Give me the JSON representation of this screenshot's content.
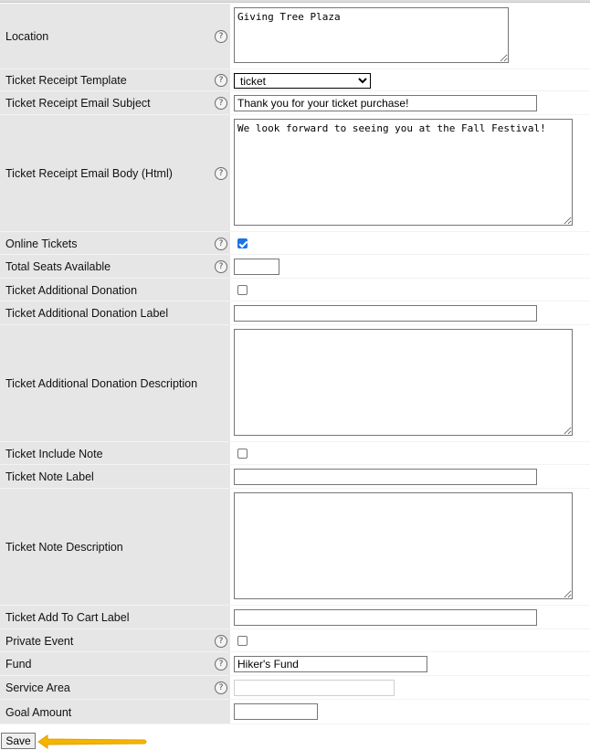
{
  "form": {
    "fields": [
      {
        "label": "Location",
        "has_help": true,
        "type": "textarea",
        "value": "Giving Tree Plaza"
      },
      {
        "label": "Ticket Receipt Template",
        "has_help": true,
        "type": "select",
        "value": "ticket"
      },
      {
        "label": "Ticket Receipt Email Subject",
        "has_help": true,
        "type": "text",
        "value": "Thank you for your ticket purchase!"
      },
      {
        "label": "Ticket Receipt Email Body (Html)",
        "has_help": true,
        "type": "textarea",
        "value": "We look forward to seeing you at the Fall Festival!"
      },
      {
        "label": "Online Tickets",
        "has_help": true,
        "type": "checkbox",
        "checked": true
      },
      {
        "label": "Total Seats Available",
        "has_help": true,
        "type": "text",
        "value": ""
      },
      {
        "label": "Ticket Additional Donation",
        "has_help": false,
        "type": "checkbox",
        "checked": false
      },
      {
        "label": "Ticket Additional Donation Label",
        "has_help": false,
        "type": "text",
        "value": ""
      },
      {
        "label": "Ticket Additional Donation Description",
        "has_help": false,
        "type": "textarea",
        "value": ""
      },
      {
        "label": "Ticket Include Note",
        "has_help": false,
        "type": "checkbox",
        "checked": false
      },
      {
        "label": "Ticket Note Label",
        "has_help": false,
        "type": "text",
        "value": ""
      },
      {
        "label": "Ticket Note Description",
        "has_help": false,
        "type": "textarea",
        "value": ""
      },
      {
        "label": "Ticket Add To Cart Label",
        "has_help": false,
        "type": "text",
        "value": ""
      },
      {
        "label": "Private Event",
        "has_help": true,
        "type": "checkbox",
        "checked": false
      },
      {
        "label": "Fund",
        "has_help": true,
        "type": "text",
        "value": "Hiker's Fund"
      },
      {
        "label": "Service Area",
        "has_help": true,
        "type": "text",
        "value": "",
        "disabled": true
      },
      {
        "label": "Goal Amount",
        "has_help": false,
        "type": "text",
        "value": ""
      }
    ],
    "help_icon_text": "?",
    "save_label": "Save"
  },
  "colors": {
    "label_bg": "#e6e6e6",
    "checkbox_accent": "#1a73e8",
    "annotation_arrow": "#f5b400"
  },
  "icons": {
    "help": "question-circle-icon",
    "arrow": "arrow-left-icon"
  }
}
